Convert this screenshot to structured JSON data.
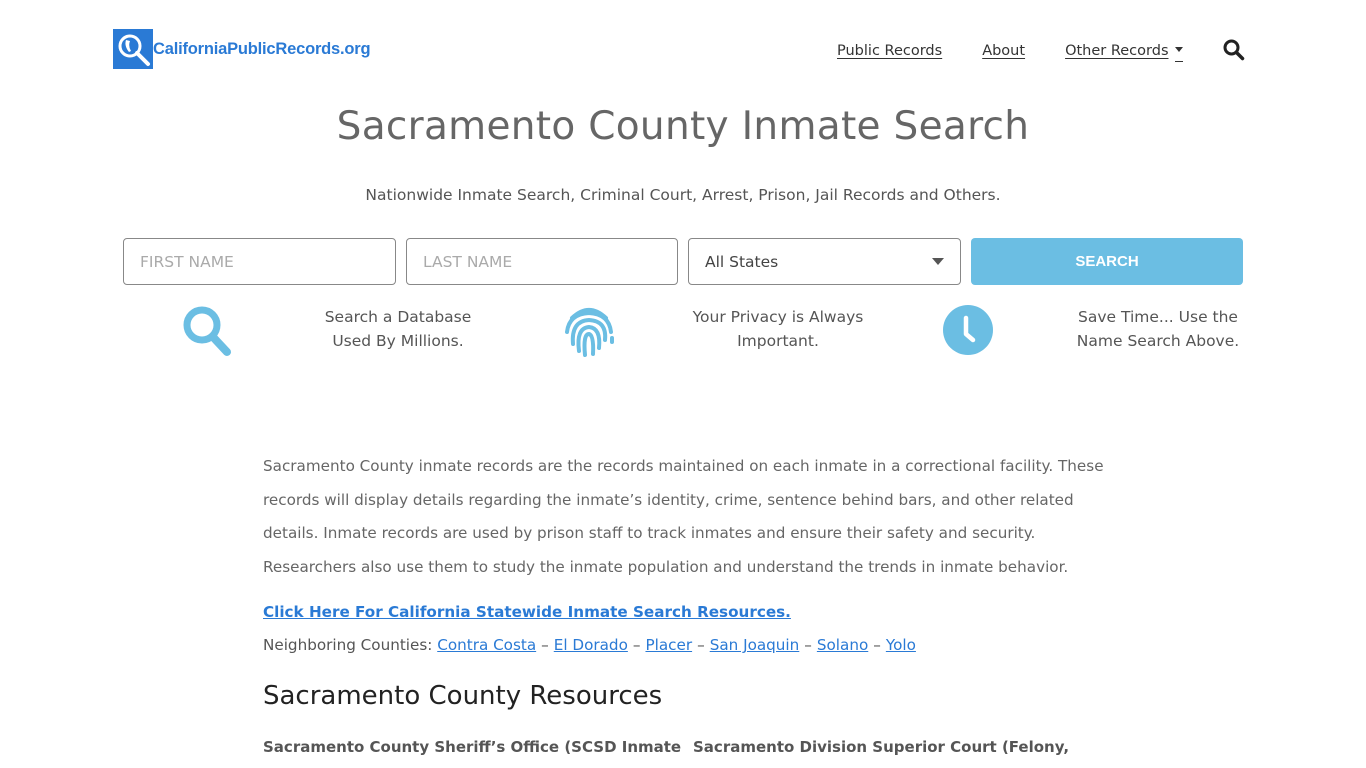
{
  "header": {
    "logo_text": "CaliforniaPublicRecords.org",
    "nav": [
      {
        "label": "Public Records"
      },
      {
        "label": "About"
      },
      {
        "label": "Other Records",
        "has_dropdown": true
      }
    ],
    "search_icon": "search-icon"
  },
  "hero": {
    "title": "Sacramento County Inmate Search",
    "subtitle": "Nationwide Inmate Search, Criminal Court, Arrest, Prison, Jail Records and Others."
  },
  "search_form": {
    "first_name_placeholder": "FIRST NAME",
    "first_name_value": "",
    "last_name_placeholder": "LAST NAME",
    "last_name_value": "",
    "state_selected": "All States",
    "submit_label": "SEARCH",
    "accent_color": "#6bbee3"
  },
  "features": [
    {
      "icon": "search-icon",
      "line1": "Search a Database",
      "line2": "Used By Millions."
    },
    {
      "icon": "fingerprint-icon",
      "line1": "Your Privacy is Always",
      "line2": "Important."
    },
    {
      "icon": "clock-icon",
      "line1": "Save Time... Use the",
      "line2": "Name Search Above."
    }
  ],
  "content": {
    "intro": "Sacramento County inmate records are the records maintained on each inmate in a correctional facility. These records will display details regarding the inmate’s identity, crime, sentence behind bars, and other related details. Inmate records are used by prison staff to track inmates and ensure their safety and security. Researchers also use them to study the inmate population and understand the trends in inmate behavior.",
    "statewide_link": "Click Here For California Statewide Inmate Search Resources.",
    "neighbors_label": "Neighboring Counties:",
    "neighbors": [
      "Contra Costa",
      "El Dorado",
      "Placer",
      "San Joaquin",
      "Solano",
      "Yolo"
    ],
    "neighbor_separator": "–",
    "resources_heading": "Sacramento County Resources",
    "resources": [
      {
        "title": "Sacramento County Sheriff’s Office (SCSD Inmate"
      },
      {
        "title": "Sacramento Division Superior Court (Felony,"
      }
    ]
  },
  "colors": {
    "brand": "#2a7ad5",
    "accent": "#6bbee3",
    "text": "#666666"
  }
}
